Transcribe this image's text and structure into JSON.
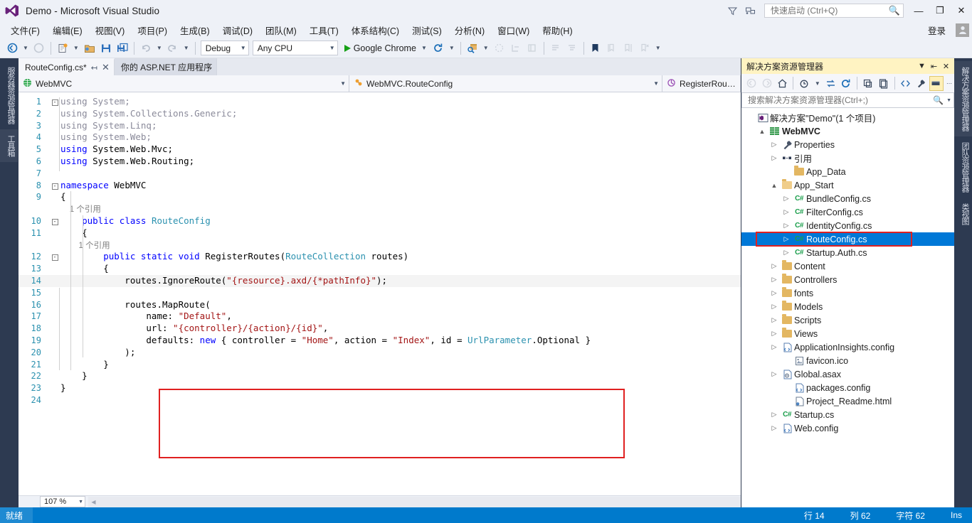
{
  "window": {
    "title": "Demo - Microsoft Visual Studio",
    "minimize": "—",
    "maximize": "❐",
    "close": "✕"
  },
  "quick_launch": {
    "placeholder": "快速启动 (Ctrl+Q)",
    "value": ""
  },
  "menu": {
    "items": [
      {
        "label": "文件(F)"
      },
      {
        "label": "编辑(E)"
      },
      {
        "label": "视图(V)"
      },
      {
        "label": "项目(P)"
      },
      {
        "label": "生成(B)"
      },
      {
        "label": "调试(D)"
      },
      {
        "label": "团队(M)"
      },
      {
        "label": "工具(T)"
      },
      {
        "label": "体系结构(C)"
      },
      {
        "label": "测试(S)"
      },
      {
        "label": "分析(N)"
      },
      {
        "label": "窗口(W)"
      },
      {
        "label": "帮助(H)"
      }
    ],
    "sign_in": "登录"
  },
  "toolbar": {
    "config": "Debug",
    "platform": "Any CPU",
    "run_target": "Google Chrome"
  },
  "editor": {
    "tabs": [
      {
        "label": "RouteConfig.cs*",
        "active": true,
        "close": "✕",
        "pin": "↤"
      },
      {
        "label": "你的 ASP.NET 应用程序",
        "active": false
      }
    ],
    "nav": {
      "project": "WebMVC",
      "type": "WebMVC.RouteConfig",
      "member": "RegisterRoutes(Rout"
    },
    "zoom": "107 %",
    "lines": [
      {
        "n": "1",
        "fold": "-",
        "tokens": [
          {
            "t": "using ",
            "c": "kw dim"
          },
          {
            "t": "System;",
            "c": "dim"
          }
        ]
      },
      {
        "n": "2",
        "fold": "",
        "tokens": [
          {
            "t": "using ",
            "c": "kw dim"
          },
          {
            "t": "System.Collections.Generic;",
            "c": "dim"
          }
        ]
      },
      {
        "n": "3",
        "fold": "",
        "tokens": [
          {
            "t": "using ",
            "c": "kw dim"
          },
          {
            "t": "System.Linq;",
            "c": "dim"
          }
        ]
      },
      {
        "n": "4",
        "fold": "",
        "tokens": [
          {
            "t": "using ",
            "c": "kw dim"
          },
          {
            "t": "System.Web;",
            "c": "dim"
          }
        ]
      },
      {
        "n": "5",
        "fold": "",
        "tokens": [
          {
            "t": "using ",
            "c": "kw"
          },
          {
            "t": "System.Web.Mvc;",
            "c": ""
          }
        ]
      },
      {
        "n": "6",
        "fold": "",
        "tokens": [
          {
            "t": "using ",
            "c": "kw"
          },
          {
            "t": "System.Web.Routing;",
            "c": ""
          }
        ]
      },
      {
        "n": "7",
        "fold": "",
        "tokens": []
      },
      {
        "n": "8",
        "fold": "-",
        "tokens": [
          {
            "t": "namespace ",
            "c": "kw"
          },
          {
            "t": "WebMVC",
            "c": "ns"
          }
        ]
      },
      {
        "n": "9",
        "fold": "",
        "tokens": [
          {
            "t": "{",
            "c": ""
          }
        ]
      },
      {
        "n": "",
        "fold": "",
        "tokens": [
          {
            "t": "    1 个引用",
            "c": "cref"
          }
        ]
      },
      {
        "n": "10",
        "fold": "-",
        "tokens": [
          {
            "t": "    ",
            "c": ""
          },
          {
            "t": "public class ",
            "c": "kw"
          },
          {
            "t": "RouteConfig",
            "c": "type"
          }
        ]
      },
      {
        "n": "11",
        "fold": "",
        "tokens": [
          {
            "t": "    {",
            "c": ""
          }
        ]
      },
      {
        "n": "",
        "fold": "",
        "tokens": [
          {
            "t": "        1 个引用",
            "c": "cref"
          }
        ]
      },
      {
        "n": "12",
        "fold": "-",
        "tokens": [
          {
            "t": "        ",
            "c": ""
          },
          {
            "t": "public static void ",
            "c": "kw"
          },
          {
            "t": "RegisterRoutes(",
            "c": ""
          },
          {
            "t": "RouteCollection",
            "c": "type"
          },
          {
            "t": " routes)",
            "c": ""
          }
        ]
      },
      {
        "n": "13",
        "fold": "",
        "tokens": [
          {
            "t": "        {",
            "c": ""
          }
        ]
      },
      {
        "n": "14",
        "fold": "",
        "current": true,
        "edited": true,
        "tokens": [
          {
            "t": "            routes.IgnoreRoute(",
            "c": ""
          },
          {
            "t": "\"{resource}.axd/{*pathInfo}\"",
            "c": "str"
          },
          {
            "t": ");",
            "c": ""
          }
        ]
      },
      {
        "n": "15",
        "fold": "",
        "tokens": []
      },
      {
        "n": "16",
        "fold": "",
        "tokens": [
          {
            "t": "            routes.MapRoute(",
            "c": ""
          }
        ]
      },
      {
        "n": "17",
        "fold": "",
        "tokens": [
          {
            "t": "                name: ",
            "c": ""
          },
          {
            "t": "\"Default\"",
            "c": "str"
          },
          {
            "t": ",",
            "c": ""
          }
        ]
      },
      {
        "n": "18",
        "fold": "",
        "tokens": [
          {
            "t": "                url: ",
            "c": ""
          },
          {
            "t": "\"{controller}/{action}/{id}\"",
            "c": "str"
          },
          {
            "t": ",",
            "c": ""
          }
        ]
      },
      {
        "n": "19",
        "fold": "",
        "tokens": [
          {
            "t": "                defaults: ",
            "c": ""
          },
          {
            "t": "new ",
            "c": "kw"
          },
          {
            "t": "{ controller = ",
            "c": ""
          },
          {
            "t": "\"Home\"",
            "c": "str"
          },
          {
            "t": ", action = ",
            "c": ""
          },
          {
            "t": "\"Index\"",
            "c": "str"
          },
          {
            "t": ", id = ",
            "c": ""
          },
          {
            "t": "UrlParameter",
            "c": "type"
          },
          {
            "t": ".Optional }",
            "c": ""
          }
        ]
      },
      {
        "n": "20",
        "fold": "",
        "tokens": [
          {
            "t": "            );",
            "c": ""
          }
        ]
      },
      {
        "n": "21",
        "fold": "",
        "tokens": [
          {
            "t": "        }",
            "c": ""
          }
        ]
      },
      {
        "n": "22",
        "fold": "",
        "tokens": [
          {
            "t": "    }",
            "c": ""
          }
        ]
      },
      {
        "n": "23",
        "fold": "",
        "tokens": [
          {
            "t": "}",
            "c": ""
          }
        ]
      },
      {
        "n": "24",
        "fold": "",
        "tokens": []
      }
    ]
  },
  "dock_left": {
    "tabs": [
      {
        "label": "服务器资源管理器"
      },
      {
        "label": "工具箱"
      }
    ]
  },
  "dock_right": {
    "tabs": [
      {
        "label": "解决方案资源管理器"
      },
      {
        "label": "团队资源管理器"
      },
      {
        "label": "类视图"
      }
    ]
  },
  "solution_explorer": {
    "title": "解决方案资源管理器",
    "search_placeholder": "搜索解决方案资源管理器(Ctrl+;)",
    "search_value": "",
    "tree": [
      {
        "label": "解决方案\"Demo\"(1 个项目)",
        "indent": 0,
        "twist": "",
        "icon": "solution-icon",
        "bold": false,
        "selected": false
      },
      {
        "label": "WebMVC",
        "indent": 1,
        "twist": "▲",
        "icon": "project-icon",
        "bold": true,
        "selected": false
      },
      {
        "label": "Properties",
        "indent": 2,
        "twist": "▷",
        "icon": "wrench-icon",
        "bold": false,
        "selected": false
      },
      {
        "label": "引用",
        "indent": 2,
        "twist": "▷",
        "icon": "reference-icon",
        "bold": false,
        "selected": false
      },
      {
        "label": "App_Data",
        "indent": 3,
        "twist": "",
        "icon": "folder-icon",
        "bold": false,
        "selected": false
      },
      {
        "label": "App_Start",
        "indent": 2,
        "twist": "▲",
        "icon": "folder-open-icon",
        "bold": false,
        "selected": false
      },
      {
        "label": "BundleConfig.cs",
        "indent": 3,
        "twist": "▷",
        "icon": "csharp-icon",
        "bold": false,
        "selected": false
      },
      {
        "label": "FilterConfig.cs",
        "indent": 3,
        "twist": "▷",
        "icon": "csharp-icon",
        "bold": false,
        "selected": false
      },
      {
        "label": "IdentityConfig.cs",
        "indent": 3,
        "twist": "▷",
        "icon": "csharp-icon",
        "bold": false,
        "selected": false
      },
      {
        "label": "RouteConfig.cs",
        "indent": 3,
        "twist": "▷",
        "icon": "csharp-icon",
        "bold": false,
        "selected": true
      },
      {
        "label": "Startup.Auth.cs",
        "indent": 3,
        "twist": "▷",
        "icon": "csharp-icon",
        "bold": false,
        "selected": false
      },
      {
        "label": "Content",
        "indent": 2,
        "twist": "▷",
        "icon": "folder-icon",
        "bold": false,
        "selected": false
      },
      {
        "label": "Controllers",
        "indent": 2,
        "twist": "▷",
        "icon": "folder-icon",
        "bold": false,
        "selected": false
      },
      {
        "label": "fonts",
        "indent": 2,
        "twist": "▷",
        "icon": "folder-icon",
        "bold": false,
        "selected": false
      },
      {
        "label": "Models",
        "indent": 2,
        "twist": "▷",
        "icon": "folder-icon",
        "bold": false,
        "selected": false
      },
      {
        "label": "Scripts",
        "indent": 2,
        "twist": "▷",
        "icon": "folder-icon",
        "bold": false,
        "selected": false
      },
      {
        "label": "Views",
        "indent": 2,
        "twist": "▷",
        "icon": "folder-icon",
        "bold": false,
        "selected": false
      },
      {
        "label": "ApplicationInsights.config",
        "indent": 2,
        "twist": "▷",
        "icon": "config-icon",
        "bold": false,
        "selected": false
      },
      {
        "label": "favicon.ico",
        "indent": 3,
        "twist": "",
        "icon": "image-icon",
        "bold": false,
        "selected": false
      },
      {
        "label": "Global.asax",
        "indent": 2,
        "twist": "▷",
        "icon": "asax-icon",
        "bold": false,
        "selected": false
      },
      {
        "label": "packages.config",
        "indent": 3,
        "twist": "",
        "icon": "config-icon",
        "bold": false,
        "selected": false
      },
      {
        "label": "Project_Readme.html",
        "indent": 3,
        "twist": "",
        "icon": "html-icon",
        "bold": false,
        "selected": false
      },
      {
        "label": "Startup.cs",
        "indent": 2,
        "twist": "▷",
        "icon": "csharp-icon",
        "bold": false,
        "selected": false
      },
      {
        "label": "Web.config",
        "indent": 2,
        "twist": "▷",
        "icon": "config-icon",
        "bold": false,
        "selected": false
      }
    ]
  },
  "statusbar": {
    "ready": "就绪",
    "line": "行 14",
    "column": "列 62",
    "character": "字符 62",
    "insert": "Ins"
  },
  "colors": {
    "accent_blue": "#007acc",
    "selection_blue": "#0078d7",
    "highlight_red": "#e02020",
    "title_yellow": "#fff3c2",
    "dock_navy": "#2d3a51"
  }
}
